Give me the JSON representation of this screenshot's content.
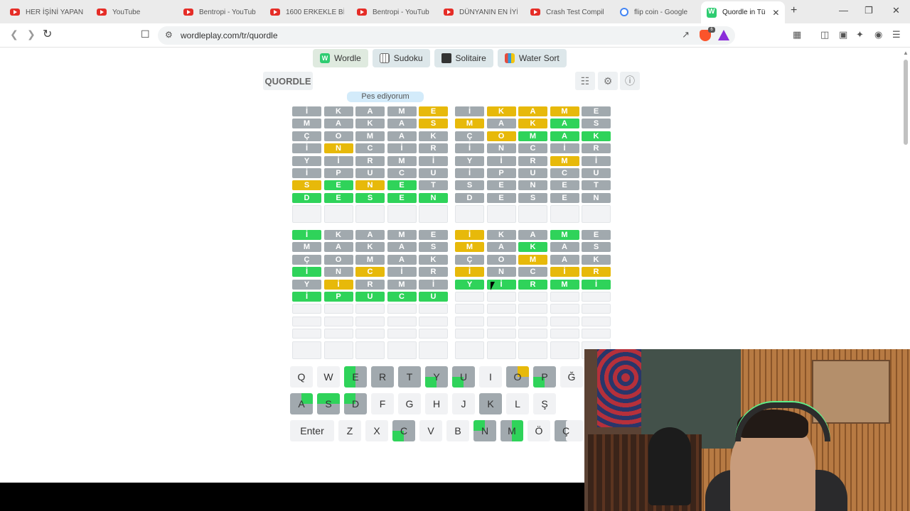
{
  "browser": {
    "tabs": [
      {
        "label": "HER İŞİNİ YAPAN",
        "icon": "youtube-icon"
      },
      {
        "label": "YouTube",
        "icon": "youtube-icon"
      },
      {
        "label": "Bentropi - YouTub",
        "icon": "youtube-icon"
      },
      {
        "label": "1600 ERKEKLE BİR",
        "icon": "youtube-icon"
      },
      {
        "label": "Bentropi - YouTub",
        "icon": "youtube-icon"
      },
      {
        "label": "DÜNYANIN EN İYİ",
        "icon": "youtube-icon"
      },
      {
        "label": "Crash Test Compil",
        "icon": "youtube-icon"
      },
      {
        "label": "flip coin - Google",
        "icon": "google-icon"
      },
      {
        "label": "Quordle in Tü",
        "icon": "wordle-icon",
        "active": true
      }
    ],
    "url": "wordleplay.com/tr/quordle",
    "brave_badge": "6"
  },
  "game_nav": [
    {
      "label": "Wordle"
    },
    {
      "label": "Sudoku"
    },
    {
      "label": "Solitaire"
    },
    {
      "label": "Water Sort"
    }
  ],
  "header": {
    "title": "QUORDLE",
    "give_up": "Pes ediyorum"
  },
  "boards": [
    {
      "rows": [
        [
          "İ",
          "K",
          "A",
          "M",
          "E"
        ],
        [
          "M",
          "A",
          "K",
          "A",
          "S"
        ],
        [
          "Ç",
          "O",
          "M",
          "A",
          "K"
        ],
        [
          "İ",
          "N",
          "C",
          "İ",
          "R"
        ],
        [
          "Y",
          "İ",
          "R",
          "M",
          "İ"
        ],
        [
          "İ",
          "P",
          "U",
          "C",
          "U"
        ],
        [
          "S",
          "E",
          "N",
          "E",
          "T"
        ],
        [
          "D",
          "E",
          "S",
          "E",
          "N"
        ]
      ],
      "states": [
        "xxxxy",
        "xxxxy",
        "xxxxx",
        "xyxxx",
        "xxxxx",
        "xxxxx",
        "ygygx",
        "ggggg"
      ],
      "empty_rows": 1
    },
    {
      "rows": [
        [
          "İ",
          "K",
          "A",
          "M",
          "E"
        ],
        [
          "M",
          "A",
          "K",
          "A",
          "S"
        ],
        [
          "Ç",
          "O",
          "M",
          "A",
          "K"
        ],
        [
          "İ",
          "N",
          "C",
          "İ",
          "R"
        ],
        [
          "Y",
          "İ",
          "R",
          "M",
          "İ"
        ],
        [
          "İ",
          "P",
          "U",
          "C",
          "U"
        ],
        [
          "S",
          "E",
          "N",
          "E",
          "T"
        ],
        [
          "D",
          "E",
          "S",
          "E",
          "N"
        ]
      ],
      "states": [
        "xyyyx",
        "yxygx",
        "xyggg",
        "xxxxx",
        "xxxyx",
        "xxxxx",
        "xxxxx",
        "xxxxx"
      ],
      "empty_rows": 1
    },
    {
      "rows": [
        [
          "İ",
          "K",
          "A",
          "M",
          "E"
        ],
        [
          "M",
          "A",
          "K",
          "A",
          "S"
        ],
        [
          "Ç",
          "O",
          "M",
          "A",
          "K"
        ],
        [
          "İ",
          "N",
          "C",
          "İ",
          "R"
        ],
        [
          "Y",
          "İ",
          "R",
          "M",
          "İ"
        ],
        [
          "İ",
          "P",
          "U",
          "C",
          "U"
        ]
      ],
      "states": [
        "gxxxx",
        "xxxxx",
        "xxxxx",
        "gxyxx",
        "xyxxx",
        "ggggg"
      ],
      "empty_rows": 4
    },
    {
      "rows": [
        [
          "İ",
          "K",
          "A",
          "M",
          "E"
        ],
        [
          "M",
          "A",
          "K",
          "A",
          "S"
        ],
        [
          "Ç",
          "O",
          "M",
          "A",
          "K"
        ],
        [
          "İ",
          "N",
          "C",
          "İ",
          "R"
        ],
        [
          "Y",
          "İ",
          "R",
          "M",
          "İ"
        ]
      ],
      "states": [
        "yxxgx",
        "yxgxx",
        "xxyxx",
        "yxxyy",
        "ggggg"
      ],
      "empty_rows": 5
    }
  ],
  "keyboard": {
    "rows": [
      [
        "Q",
        "W",
        "E",
        "R",
        "T",
        "Y",
        "U",
        "I",
        "O",
        "P",
        "Ğ"
      ],
      [
        "A",
        "S",
        "D",
        "F",
        "G",
        "H",
        "J",
        "K",
        "L",
        "Ş"
      ],
      [
        "Enter",
        "Z",
        "X",
        "C",
        "V",
        "B",
        "N",
        "M",
        "Ö",
        "Ç"
      ]
    ]
  },
  "colors": {
    "gray": "#a1a9ae",
    "yellow": "#e7b90a",
    "green": "#2fd35a"
  }
}
